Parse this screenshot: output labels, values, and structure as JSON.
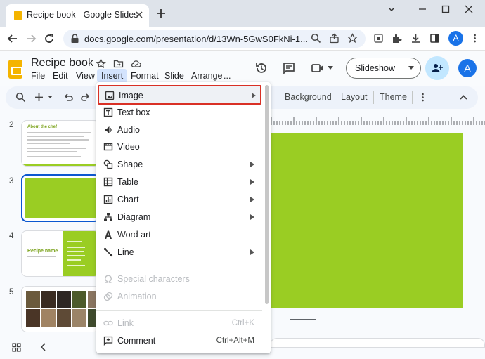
{
  "browser": {
    "tab_title": "Recipe book - Google Slides",
    "url": "docs.google.com/presentation/d/13Wn-5GwS0FkNi-1...",
    "profile_initial": "A"
  },
  "app": {
    "doc_title": "Recipe book",
    "menus": [
      "File",
      "Edit",
      "View",
      "Insert",
      "Format",
      "Slide",
      "Arrange",
      "..."
    ],
    "slideshow_label": "Slideshow",
    "avatar_initial": "A",
    "accent": "#0b57d0"
  },
  "toolbar": {
    "background_label": "Background",
    "layout_label": "Layout",
    "theme_label": "Theme"
  },
  "filmstrip": {
    "slides": [
      {
        "number": "2",
        "heading": "About the chef"
      },
      {
        "number": "3"
      },
      {
        "number": "4",
        "heading": "Recipe name"
      },
      {
        "number": "5"
      }
    ]
  },
  "slide_color": "#9acd23",
  "insert_menu": {
    "items": [
      {
        "label": "Image",
        "icon": "image-icon",
        "submenu": true,
        "highlighted": true
      },
      {
        "label": "Text box",
        "icon": "text-box-icon"
      },
      {
        "label": "Audio",
        "icon": "audio-icon"
      },
      {
        "label": "Video",
        "icon": "video-icon"
      },
      {
        "label": "Shape",
        "icon": "shape-icon",
        "submenu": true
      },
      {
        "label": "Table",
        "icon": "table-icon",
        "submenu": true
      },
      {
        "label": "Chart",
        "icon": "chart-icon",
        "submenu": true
      },
      {
        "label": "Diagram",
        "icon": "diagram-icon",
        "submenu": true
      },
      {
        "label": "Word art",
        "icon": "word-art-icon"
      },
      {
        "label": "Line",
        "icon": "line-icon",
        "submenu": true
      },
      {
        "label": "Special characters",
        "icon": "omega-icon",
        "disabled": true
      },
      {
        "label": "Animation",
        "icon": "animation-icon",
        "disabled": true
      },
      {
        "label": "Link",
        "icon": "link-icon",
        "shortcut": "Ctrl+K",
        "disabled": true
      },
      {
        "label": "Comment",
        "icon": "comment-icon",
        "shortcut": "Ctrl+Alt+M"
      }
    ]
  }
}
